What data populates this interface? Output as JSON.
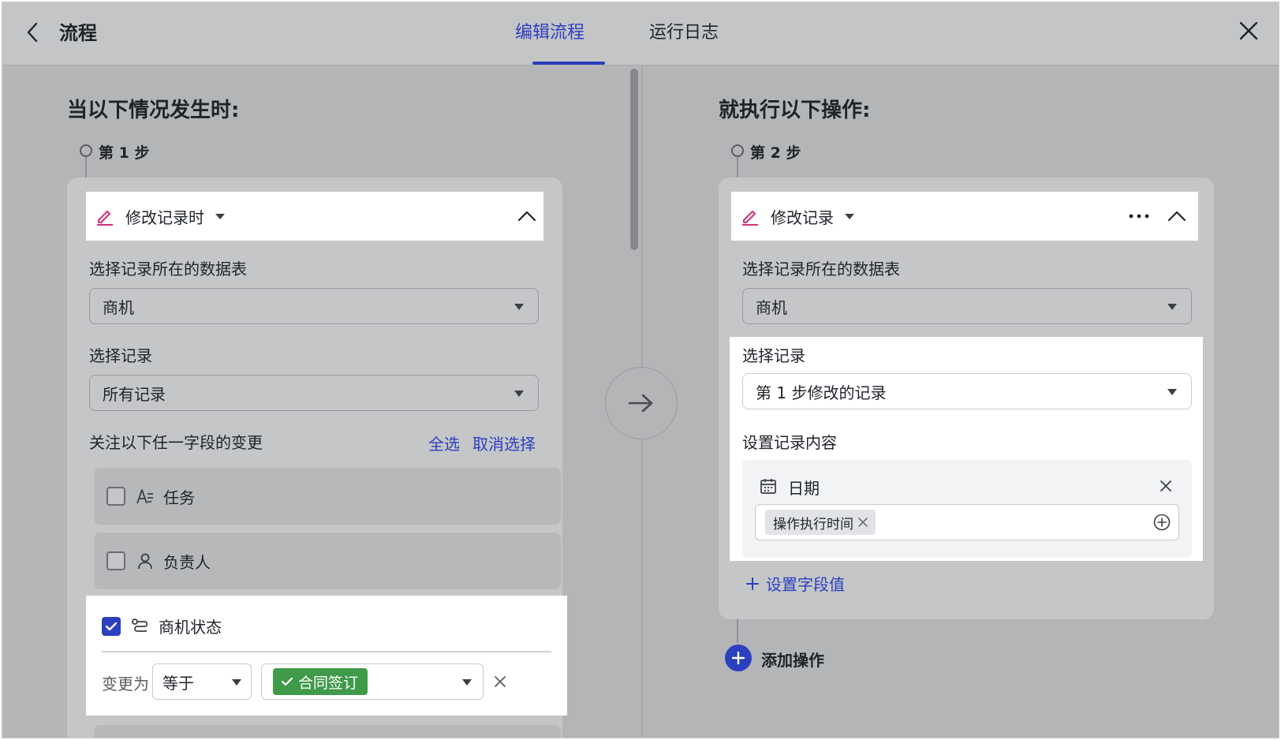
{
  "header": {
    "title": "流程",
    "tabs": [
      {
        "label": "编辑流程",
        "active": true
      },
      {
        "label": "运行日志",
        "active": false
      }
    ]
  },
  "trigger": {
    "section_title": "当以下情况发生时:",
    "step_label": "第 1 步",
    "head": "修改记录时",
    "table_label": "选择记录所在的数据表",
    "table_value": "商机",
    "record_label": "选择记录",
    "record_value": "所有记录",
    "watch_label": "关注以下任一字段的变更",
    "select_all": "全选",
    "deselect": "取消选择",
    "fields": [
      {
        "name": "任务",
        "checked": false
      },
      {
        "name": "负责人",
        "checked": false
      },
      {
        "name": "商机状态",
        "checked": true
      }
    ],
    "condition": {
      "change_to_label": "变更为",
      "operator": "等于",
      "value": "合同签订"
    }
  },
  "action": {
    "section_title": "就执行以下操作:",
    "step_label": "第 2 步",
    "head": "修改记录",
    "table_label": "选择记录所在的数据表",
    "table_value": "商机",
    "record_label": "选择记录",
    "record_value": "第 1 步修改的记录",
    "content_label": "设置记录内容",
    "field_name": "日期",
    "field_tag": "操作执行时间",
    "set_field_link": "设置字段值",
    "add_operation": "添加操作"
  },
  "colors": {
    "accent": "#2b3fbf",
    "status_green": "#3f9a4a",
    "pencil_pink": "#d0307a"
  }
}
